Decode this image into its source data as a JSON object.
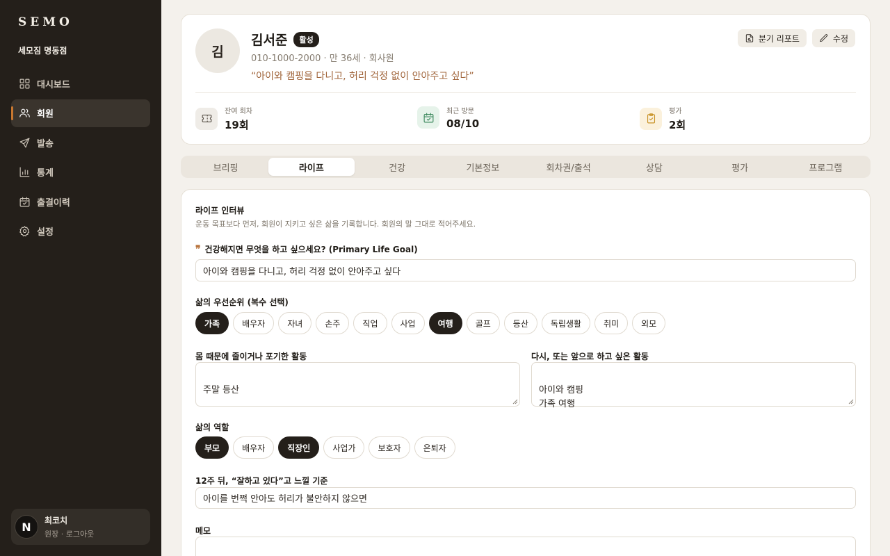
{
  "sidebar": {
    "brand": "SEMO",
    "branch": "세모짐 명동점",
    "items": [
      {
        "label": "대시보드",
        "icon": "grid-icon"
      },
      {
        "label": "회원",
        "icon": "users-icon"
      },
      {
        "label": "발송",
        "icon": "send-icon"
      },
      {
        "label": "통계",
        "icon": "chart-icon"
      },
      {
        "label": "출결이력",
        "icon": "calendar-check-icon"
      },
      {
        "label": "설정",
        "icon": "gear-icon"
      }
    ],
    "active_item": "회원",
    "user": {
      "avatar": "N",
      "name": "최코치",
      "sub": "원장 · 로그아웃"
    }
  },
  "profile": {
    "avatar": "김",
    "name": "김서준",
    "status": "활성",
    "info": "010-1000-2000 · 만 36세 · 회사원",
    "quote": "“아이와 캠핑을 다니고, 허리 걱정 없이 안아주고 싶다”",
    "buttons": {
      "report": "분기 리포트",
      "edit": "수정"
    },
    "stats": [
      {
        "label": "잔여 회차",
        "value": "19회",
        "icon": "ticket-icon",
        "color": "#5a534a",
        "bg": "#efece7"
      },
      {
        "label": "최근 방문",
        "value": "08/10",
        "icon": "calendar-check-icon",
        "color": "#3f8a5f",
        "bg": "#e6f3ea"
      },
      {
        "label": "평가",
        "value": "2회",
        "icon": "clipboard-icon",
        "color": "#c89226",
        "bg": "#fbf1dc"
      }
    ]
  },
  "tabs": [
    "브리핑",
    "라이프",
    "건강",
    "기본정보",
    "회차권/출석",
    "상담",
    "평가",
    "프로그램"
  ],
  "active_tab": "라이프",
  "life": {
    "title": "라이프 인터뷰",
    "description": "운동 목표보다 먼저, 회원이 지키고 싶은 삶을 기록합니다. 회원의 말 그대로 적어주세요.",
    "goal_label": "건강해지면 무엇을 하고 싶으세요? (Primary Life Goal)",
    "goal_value": "아이와 캠핑을 다니고, 허리 걱정 없이 안아주고 싶다",
    "priority_label": "삶의 우선순위 (복수 선택)",
    "priorities": [
      {
        "label": "가족",
        "selected": true
      },
      {
        "label": "배우자",
        "selected": false
      },
      {
        "label": "자녀",
        "selected": false
      },
      {
        "label": "손주",
        "selected": false
      },
      {
        "label": "직업",
        "selected": false
      },
      {
        "label": "사업",
        "selected": false
      },
      {
        "label": "여행",
        "selected": true
      },
      {
        "label": "골프",
        "selected": false
      },
      {
        "label": "등산",
        "selected": false
      },
      {
        "label": "독립생활",
        "selected": false
      },
      {
        "label": "취미",
        "selected": false
      },
      {
        "label": "외모",
        "selected": false
      }
    ],
    "given_up_label": "몸 때문에 줄이거나 포기한 활동",
    "given_up_value": "주말 등산",
    "future_label": "다시, 또는 앞으로 하고 싶은 활동",
    "future_value": "아이와 캠핑\n가족 여행",
    "roles_label": "삶의 역할",
    "roles": [
      {
        "label": "부모",
        "selected": true
      },
      {
        "label": "배우자",
        "selected": false
      },
      {
        "label": "직장인",
        "selected": true
      },
      {
        "label": "사업가",
        "selected": false
      },
      {
        "label": "보호자",
        "selected": false
      },
      {
        "label": "은퇴자",
        "selected": false
      }
    ],
    "criteria_label": "12주 뒤, “잘하고 있다”고 느낄 기준",
    "criteria_value": "아이를 번쩍 안아도 허리가 불안하지 않으면",
    "memo_label": "메모",
    "memo_value": ""
  }
}
